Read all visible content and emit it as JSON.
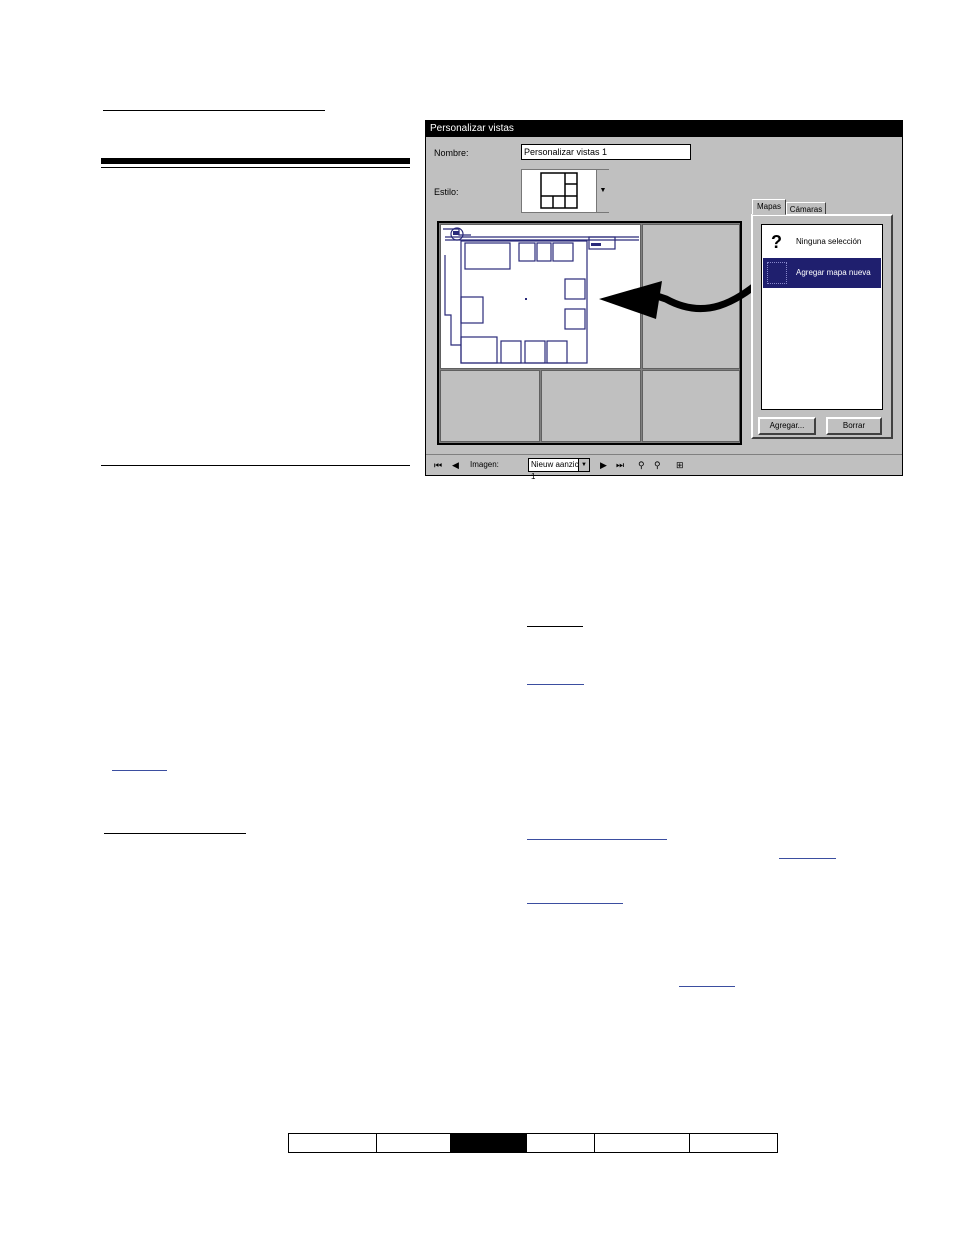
{
  "dialog": {
    "title": "Personalizar vistas",
    "name_label": "Nombre:",
    "name_value": "Personalizar vistas 1",
    "style_label": "Estilo:",
    "tabs": [
      {
        "label": "Mapas",
        "active": true
      },
      {
        "label": "Cámaras",
        "active": false
      }
    ],
    "list_items": [
      {
        "icon": "question-icon",
        "label": "Ninguna selección",
        "selected": false
      },
      {
        "icon": "map-icon",
        "label": "Agregar mapa nueva",
        "selected": true
      }
    ],
    "add_button": "Agregar...",
    "delete_button": "Borrar",
    "toolbar": {
      "view_label": "Imagen:",
      "view_value": "Nieuw aanzicht 1"
    },
    "colors": {
      "title_bar": "#000000",
      "selection": "#1f1f6e",
      "floorplan": "#2a2a7a"
    }
  },
  "footer_nav": {
    "segments": 6,
    "active_index": 2
  }
}
